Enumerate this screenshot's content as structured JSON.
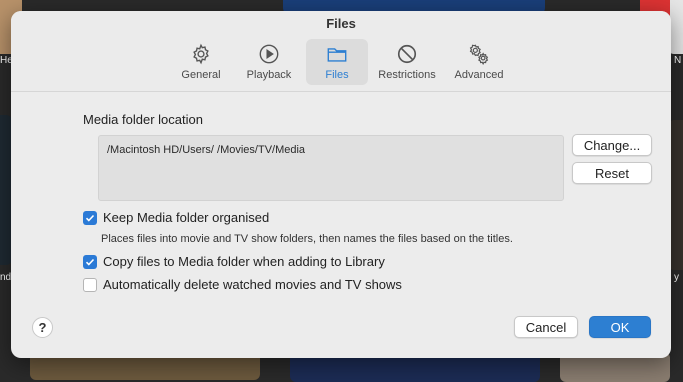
{
  "background": {
    "left_label_1": "He",
    "left_label_2": "nd",
    "right_label_1": "N",
    "right_label_2": "y"
  },
  "dialog": {
    "title": "Files",
    "tabs": [
      {
        "label": "General",
        "icon": "gear-icon"
      },
      {
        "label": "Playback",
        "icon": "play-icon"
      },
      {
        "label": "Files",
        "icon": "folder-icon",
        "active": true
      },
      {
        "label": "Restrictions",
        "icon": "restrictions-icon"
      },
      {
        "label": "Advanced",
        "icon": "gears-icon"
      }
    ],
    "media_folder_label": "Media folder location",
    "media_folder_path": "/Macintosh HD/Users/      /Movies/TV/Media",
    "change_button": "Change...",
    "reset_button": "Reset",
    "options": [
      {
        "label": "Keep Media folder organised",
        "checked": true
      },
      {
        "label": "Copy files to Media folder when adding to Library",
        "checked": true
      },
      {
        "label": "Automatically delete watched movies and TV shows",
        "checked": false
      }
    ],
    "organise_hint": "Places files into movie and TV show folders, then names the files based on the titles.",
    "help_button": "?",
    "cancel_button": "Cancel",
    "ok_button": "OK"
  },
  "colors": {
    "accent": "#2d7fd2",
    "dialog_bg": "#ececec"
  }
}
